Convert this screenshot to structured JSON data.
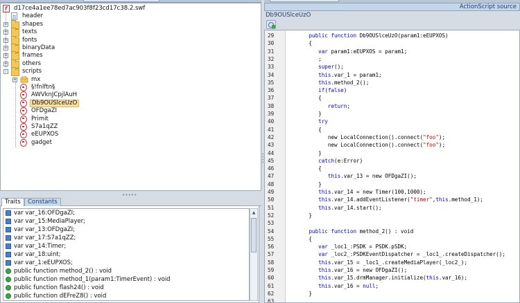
{
  "left_panel": {
    "tree": {
      "root": "d17ce4a1ee78ed7ac903f8f23cd17c38.2.swf",
      "items": [
        {
          "label": "header",
          "icon": "file-icon"
        },
        {
          "label": "shapes",
          "icon": "folder-icon"
        },
        {
          "label": "texts",
          "icon": "folder-icon"
        },
        {
          "label": "fonts",
          "icon": "folder-icon"
        },
        {
          "label": "binaryData",
          "icon": "folder-icon"
        },
        {
          "label": "frames",
          "icon": "folder-icon"
        },
        {
          "label": "others",
          "icon": "folder-icon"
        },
        {
          "label": "scripts",
          "icon": "folder-icon"
        }
      ],
      "scripts_children": [
        {
          "label": "mx",
          "icon": "package-icon"
        },
        {
          "label": "§!fnlftn§",
          "icon": "class-icon"
        },
        {
          "label": "AWVknJCpjlAuH",
          "icon": "class-icon"
        },
        {
          "label": "Db9OUSlceUzO",
          "icon": "class-icon",
          "selected": true
        },
        {
          "label": "OFDgaZI",
          "icon": "class-icon"
        },
        {
          "label": "Primit",
          "icon": "class-icon"
        },
        {
          "label": "S7a1qZZ",
          "icon": "class-icon"
        },
        {
          "label": "eEUPXOS",
          "icon": "class-icon"
        },
        {
          "label": "gadget",
          "icon": "class-icon"
        }
      ]
    },
    "tabs": [
      {
        "label": "Traits",
        "active": true
      },
      {
        "label": "Constants",
        "active": false
      }
    ],
    "traits": [
      {
        "kind": "var",
        "text": "var var_16:OFDgaZI;"
      },
      {
        "kind": "var",
        "text": "var var_15:MediaPlayer;"
      },
      {
        "kind": "var",
        "text": "var var_13:OFDgaZI;"
      },
      {
        "kind": "var",
        "text": "var var_17:S7a1qZZ;"
      },
      {
        "kind": "var",
        "text": "var var_14:Timer;"
      },
      {
        "kind": "var",
        "text": "var var_18:uint;"
      },
      {
        "kind": "var",
        "text": "var var_1:eEUPXOS;"
      },
      {
        "kind": "function",
        "text": "public function method_2() : void"
      },
      {
        "kind": "function",
        "text": "public function method_1(param1:TimerEvent) : void"
      },
      {
        "kind": "function",
        "text": "public function flash24() : void"
      },
      {
        "kind": "function",
        "text": "public function dEFreZ8() : void"
      }
    ]
  },
  "right_panel": {
    "header": "ActionScript source",
    "class_title": "Db9OUSlceUzO",
    "code": [
      {
        "n": "29",
        "t": "      public function Db9OUSlceUzO(param1:eEUPXOS)"
      },
      {
        "n": "30",
        "t": "      {"
      },
      {
        "n": "31",
        "t": "         var param1:eEUPXOS = param1;"
      },
      {
        "n": "32",
        "t": "         ;"
      },
      {
        "n": "33",
        "t": "         super();"
      },
      {
        "n": "34",
        "t": "         this.var_1 = param1;"
      },
      {
        "n": "35",
        "t": "         this.method_2();"
      },
      {
        "n": "36",
        "t": "         if(false)"
      },
      {
        "n": "37",
        "t": "         {"
      },
      {
        "n": "38",
        "t": "            return;"
      },
      {
        "n": "39",
        "t": "         }"
      },
      {
        "n": "40",
        "t": "         try"
      },
      {
        "n": "41",
        "t": "         {"
      },
      {
        "n": "42",
        "t": "            new LocalConnection().connect(\"foo\");"
      },
      {
        "n": "43",
        "t": "            new LocalConnection().connect(\"foo\");"
      },
      {
        "n": "44",
        "t": "         }"
      },
      {
        "n": "45",
        "t": "         catch(e:Error)"
      },
      {
        "n": "46",
        "t": "         {"
      },
      {
        "n": "47",
        "t": "            this.var_13 = new OFDgaZI();"
      },
      {
        "n": "48",
        "t": "         }"
      },
      {
        "n": "49",
        "t": "         this.var_14 = new Timer(100,1000);"
      },
      {
        "n": "50",
        "t": "         this.var_14.addEventListener(\"timer\",this.method_1);"
      },
      {
        "n": "51",
        "t": "         this.var_14.start();"
      },
      {
        "n": "52",
        "t": "      }"
      },
      {
        "n": "53",
        "t": ""
      },
      {
        "n": "54",
        "t": "      public function method_2() : void"
      },
      {
        "n": "55",
        "t": "      {"
      },
      {
        "n": "56",
        "t": "         var _loc1_:PSDK = PSDK.pSDK;"
      },
      {
        "n": "57",
        "t": "         var _loc2_:PSDKEventDispatcher = _loc1_.createDispatcher();"
      },
      {
        "n": "58",
        "t": "         this.var_15 = _loc1_.createMediaPlayer(_loc2_);"
      },
      {
        "n": "59",
        "t": "         this.var_16 = new OFDgaZI();"
      },
      {
        "n": "60",
        "t": "         this.var_15.drmManager.initialize(this.var_16);"
      },
      {
        "n": "61",
        "t": "         this.var_16 = null;"
      },
      {
        "n": "62",
        "t": "      }"
      },
      {
        "n": "63",
        "t": ""
      }
    ]
  }
}
